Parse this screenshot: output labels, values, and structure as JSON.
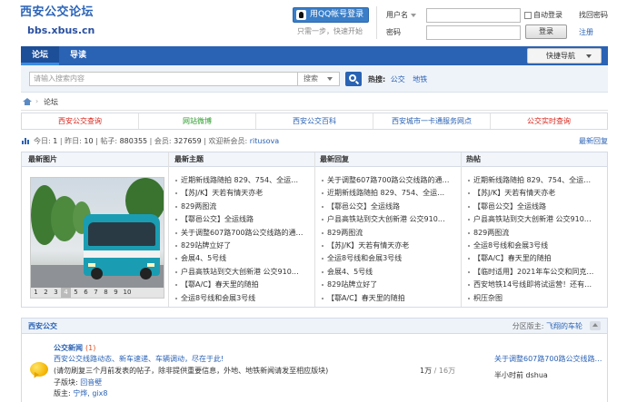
{
  "header": {
    "site_title": "西安公交论坛",
    "site_url": "bbs.xbus.cn",
    "qq_login": "用QQ帐号登录",
    "qq_sub": "只需一步，快速开始",
    "username_label": "用户名",
    "password_label": "密码",
    "auto_login": "自动登录",
    "login_button": "登录",
    "forgot": "找回密码",
    "register": "注册"
  },
  "nav": {
    "tabs": [
      "论坛",
      "导读"
    ],
    "quick_nav": "快捷导航"
  },
  "search": {
    "placeholder": "请输入搜索内容",
    "scope": "搜索",
    "hot_label": "热搜:",
    "hot_words": [
      "公交",
      "地铁"
    ]
  },
  "breadcrumb": {
    "current": "论坛"
  },
  "quick_links": [
    {
      "label": "西安公交查询",
      "color": "#d9261c"
    },
    {
      "label": "网站微博",
      "color": "#2e9c2e"
    },
    {
      "label": "西安公交百科",
      "color": "#2a62b4"
    },
    {
      "label": "西安城市一卡通服务网点",
      "color": "#2a62b4"
    },
    {
      "label": "公交实时查询",
      "color": "#d9261c"
    }
  ],
  "stats": {
    "today_label": "今日:",
    "today": "1",
    "yesterday_label": "昨日:",
    "yesterday": "10",
    "posts_label": "帖子:",
    "posts": "880355",
    "members_label": "会员:",
    "members": "327659",
    "welcome_label": "欢迎新会员:",
    "new_member": "ritusova",
    "recent": "最新回复"
  },
  "panel": {
    "headers": [
      "最新图片",
      "最新主题",
      "最新回复",
      "热帖"
    ],
    "pager": [
      "1",
      "2",
      "3",
      "4",
      "5",
      "6",
      "7",
      "8",
      "9",
      "10"
    ],
    "active_page": "4",
    "latest_topics": [
      "近期新线路随拍 829、754、全运…",
      "【苏J/K】天若有情天亦老",
      "829两图流",
      "【鄠邑公交】全运线路",
      "关于调整607路700路公交线路的通…",
      "829站牌立好了",
      "会展4、5号线",
      "户县高铁站到交大创新港 公交910…",
      "【鄠A/C】春天里的随拍",
      "全运8号线和会展3号线"
    ],
    "latest_replies": [
      "关于调整607路700路公交线路的通…",
      "近期新线路随拍 829、754、全运…",
      "【鄠邑公交】全运线路",
      "户县高铁站到交大创新港 公交910…",
      "829两图流",
      "【苏J/K】天若有情天亦老",
      "全运8号线和会展3号线",
      "会展4、5号线",
      "829站牌立好了",
      "【鄠A/C】春天里的随拍"
    ],
    "hot_posts": [
      "近期新线路随拍 829、754、全运…",
      "【苏J/K】天若有情天亦老",
      "【鄠邑公交】全运线路",
      "户县高铁站到交大创新港 公交910…",
      "829两图流",
      "全运8号线和会展3号线",
      "【鄠A/C】春天里的随拍",
      "【临时适用】2021年车公交和同克…",
      "西安地铁14号线即将试运营！还有…",
      "枳压杂图"
    ]
  },
  "section": {
    "title": "西安公交",
    "moderator_label": "分区版主:",
    "moderator": "飞翔的车轮",
    "forum": {
      "name": "公交新闻",
      "new_count": "(1)",
      "desc": "西安公交线路动态、新车速递、车辆调动，尽在于此!",
      "note": "(请勿刷复三个月前发表的帖子，除非提供重要信息，外地、地铁新闻请发至相应版块)",
      "subforum_label": "子版块:",
      "subforum": "回音壁",
      "mods_label": "版主:",
      "mods": "宁烨, gix8",
      "counts": "1万",
      "counts_sep": "/",
      "counts_total": "16万",
      "last_post": "关于调整607路700路公交线路的通…",
      "last_time": "半小时前",
      "last_user": "dshua"
    }
  },
  "colors": {
    "brand": "#2a62b4",
    "nav": "#2a62b4"
  }
}
